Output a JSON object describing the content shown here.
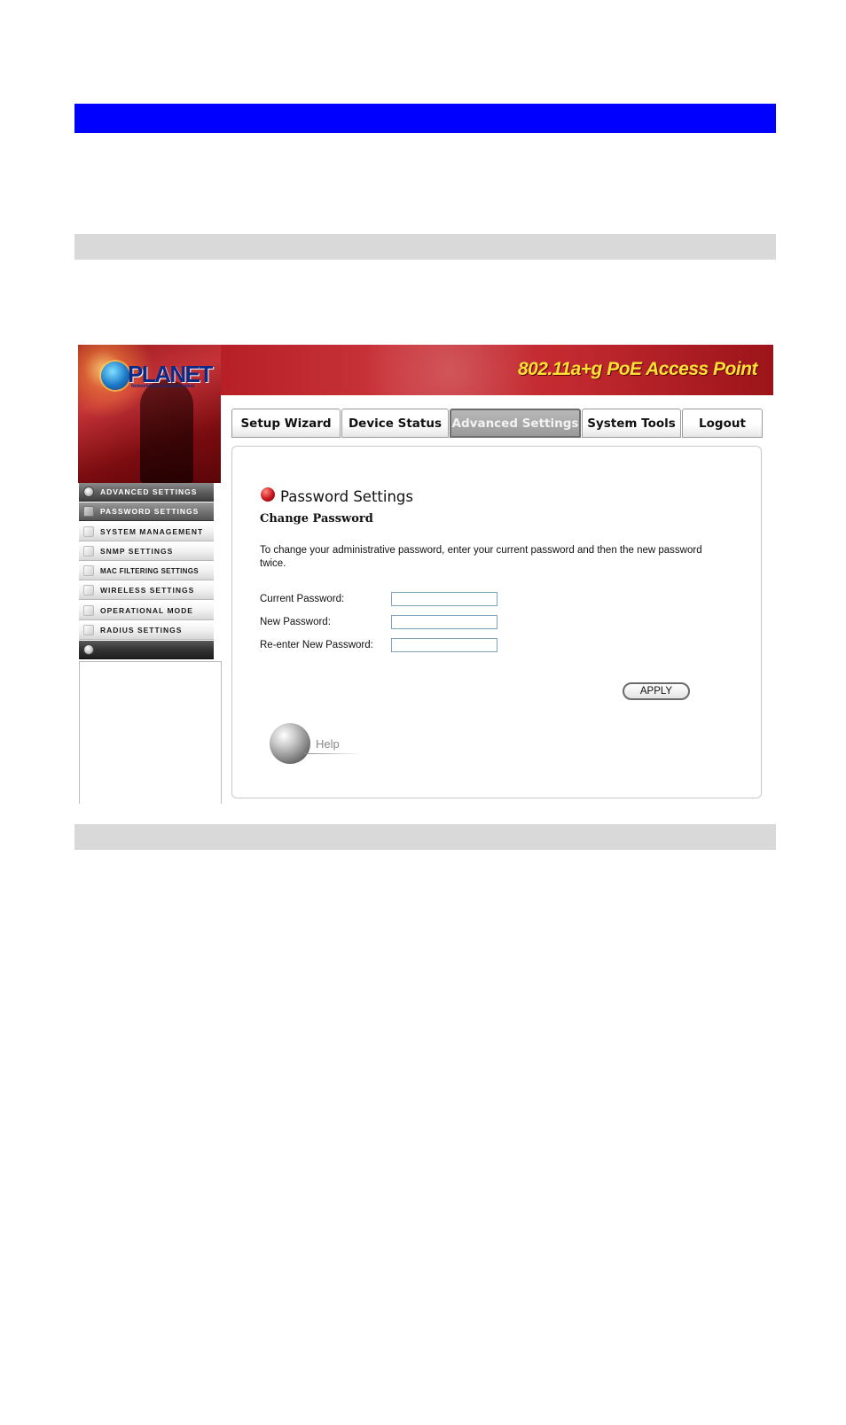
{
  "banner": {
    "brand": "PLANET",
    "brand_tagline": "Networking & Communication",
    "product_title": "802.11a+g PoE Access Point"
  },
  "tabs": [
    {
      "label": "Setup Wizard",
      "active": false
    },
    {
      "label": "Device Status",
      "active": false
    },
    {
      "label": "Advanced Settings",
      "active": true
    },
    {
      "label": "System Tools",
      "active": false
    },
    {
      "label": "Logout",
      "active": false
    }
  ],
  "sidebar": {
    "header": "Advanced Settings",
    "items": [
      {
        "label": "Password Settings",
        "active": true
      },
      {
        "label": "System Management",
        "active": false
      },
      {
        "label": "SNMP Settings",
        "active": false
      },
      {
        "label": "MAC Filtering Settings",
        "active": false
      },
      {
        "label": "Wireless Settings",
        "active": false
      },
      {
        "label": "Operational Mode",
        "active": false
      },
      {
        "label": "Radius Settings",
        "active": false
      }
    ]
  },
  "main": {
    "title": "Password Settings",
    "section_title": "Change Password",
    "intro": "To change your administrative password, enter your current password and then the new password twice.",
    "fields": [
      {
        "label": "Current Password:",
        "value": ""
      },
      {
        "label": "New Password:",
        "value": ""
      },
      {
        "label": "Re-enter New Password:",
        "value": ""
      }
    ],
    "apply_label": "APPLY",
    "help_label": "Help"
  },
  "colors": {
    "document_bar": "#0000ff",
    "section_bar": "#d9d9d9",
    "banner_red": "#c22a30",
    "banner_title": "#ffe135",
    "status_dot": "#c8141a"
  },
  "icons": {
    "logo": "planet-logo-icon",
    "title_bullet": "red-dot-icon",
    "help": "help-ball-icon"
  }
}
